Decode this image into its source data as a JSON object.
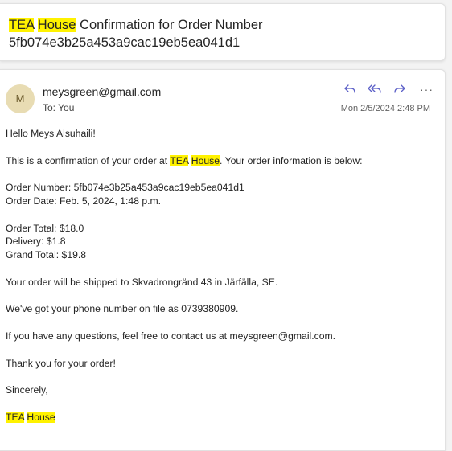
{
  "subject": {
    "brand_word1": "TEA",
    "brand_word2": "House",
    "text_rest_line1": "Confirmation for Order Number",
    "order_number": "5fb074e3b25a453a9cac19eb5ea041d1"
  },
  "header": {
    "avatar_initial": "M",
    "sender": "meysgreen@gmail.com",
    "to_label": "To:",
    "to_value": "You",
    "date": "Mon 2/5/2024 2:48 PM",
    "icons": [
      "reply-icon",
      "reply-all-icon",
      "forward-icon",
      "more-icon"
    ],
    "more_label": "···",
    "accent_color": "#5b5fc7"
  },
  "body": {
    "greeting": "Hello Meys Alsuhaili!",
    "intro_before": "This is a confirmation of your order at",
    "intro_brand1": "TEA",
    "intro_brand2": "House",
    "intro_after": ". Your order information is below:",
    "order_number_line": "Order Number: 5fb074e3b25a453a9cac19eb5ea041d1",
    "order_date_line": "Order Date: Feb. 5, 2024, 1:48 p.m.",
    "order_total_line": "Order Total: $18.0",
    "delivery_line": "Delivery: $1.8",
    "grand_total_line": "Grand Total: $19.8",
    "shipping_line": "Your order will be shipped to Skvadrongränd 43 in Järfälla, SE.",
    "phone_line": "We've got your phone number on file as 0739380909.",
    "questions_line": "If you have any questions, feel free to contact us at meysgreen@gmail.com.",
    "thanks_line": "Thank you for your order!",
    "closing": "Sincerely,",
    "sign_brand1": "TEA",
    "sign_brand2": "House"
  },
  "highlight_color": "#fff200"
}
